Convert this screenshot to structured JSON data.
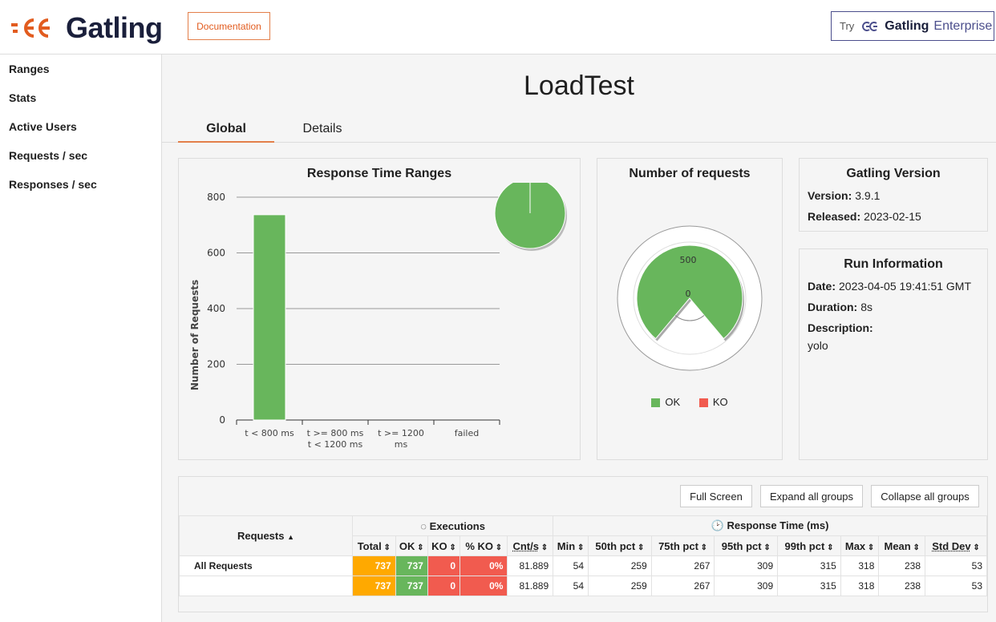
{
  "header": {
    "logo_text": "Gatling",
    "documentation_label": "Documentation",
    "enterprise_try": "Try",
    "enterprise_brand": "Gatling",
    "enterprise_suffix": "Enterprise"
  },
  "sidebar": {
    "items": [
      {
        "label": "Ranges"
      },
      {
        "label": "Stats"
      },
      {
        "label": "Active Users"
      },
      {
        "label": "Requests / sec"
      },
      {
        "label": "Responses / sec"
      }
    ]
  },
  "main": {
    "title": "LoadTest",
    "tabs": [
      {
        "label": "Global"
      },
      {
        "label": "Details"
      }
    ]
  },
  "colors": {
    "ok": "#68b65c",
    "ko": "#f15b4f",
    "total": "#ffa900",
    "accent": "#e37f4a"
  },
  "chart_data": [
    {
      "type": "bar",
      "title": "Response Time Ranges",
      "ylabel": "Number of Requests",
      "xlabel": "",
      "categories": [
        "t < 800 ms",
        "t >= 800 ms\nt < 1200 ms",
        "t >= 1200\nms",
        "failed"
      ],
      "values": [
        737,
        0,
        0,
        0
      ],
      "ylim": [
        0,
        800
      ],
      "yticks": [
        0,
        200,
        400,
        600,
        800
      ],
      "grid": true,
      "pie": {
        "ok": 737,
        "ko": 0
      }
    },
    {
      "type": "pie",
      "title": "Number of requests",
      "labels": [
        "OK",
        "KO"
      ],
      "values": [
        737,
        0
      ],
      "ticks": [
        "0",
        "500"
      ],
      "legend": "bottom"
    }
  ],
  "gatling_version": {
    "title": "Gatling Version",
    "version_label": "Version:",
    "version": "3.9.1",
    "released_label": "Released:",
    "released": "2023-02-15"
  },
  "run_info": {
    "title": "Run Information",
    "date_label": "Date:",
    "date": "2023-04-05 19:41:51 GMT",
    "duration_label": "Duration:",
    "duration": "8s",
    "description_label": "Description:",
    "description": "yolo"
  },
  "table": {
    "buttons": {
      "full_screen": "Full Screen",
      "expand": "Expand all groups",
      "collapse": "Collapse all groups"
    },
    "group_headers": {
      "requests": "Requests",
      "executions": "Executions",
      "response_time": "Response Time (ms)"
    },
    "columns": [
      "Total",
      "OK",
      "KO",
      "% KO",
      "Cnt/s",
      "Min",
      "50th pct",
      "75th pct",
      "95th pct",
      "99th pct",
      "Max",
      "Mean",
      "Std Dev"
    ],
    "rows": [
      {
        "name": "All Requests",
        "values": [
          "737",
          "737",
          "0",
          "0%",
          "81.889",
          "54",
          "259",
          "267",
          "309",
          "315",
          "318",
          "238",
          "53"
        ]
      },
      {
        "name": "",
        "values": [
          "737",
          "737",
          "0",
          "0%",
          "81.889",
          "54",
          "259",
          "267",
          "309",
          "315",
          "318",
          "238",
          "53"
        ]
      }
    ]
  }
}
